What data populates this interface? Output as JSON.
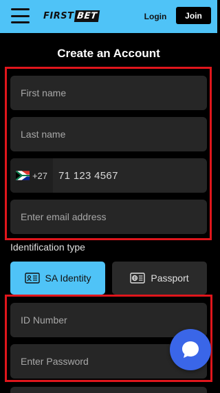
{
  "header": {
    "logo_first": "FIRST",
    "logo_bet": "BET",
    "login_label": "Login",
    "join_label": "Join"
  },
  "form": {
    "title": "Create an Account",
    "first_name_placeholder": "First name",
    "last_name_placeholder": "Last name",
    "phone": {
      "dial_code": "+27",
      "number_placeholder": "71 123 4567",
      "flag_icon": "south-africa-flag-icon"
    },
    "email_placeholder": "Enter email address",
    "identification_label": "Identification type",
    "id_tabs": [
      {
        "label": "SA Identity",
        "icon": "id-card-icon",
        "selected": true
      },
      {
        "label": "Passport",
        "icon": "passport-icon",
        "selected": false
      }
    ],
    "id_number_placeholder": "ID Number",
    "password_placeholder": "Enter Password"
  },
  "colors": {
    "accent": "#4fc3f7",
    "highlight": "#e0161c",
    "chat": "#3a66e8"
  }
}
